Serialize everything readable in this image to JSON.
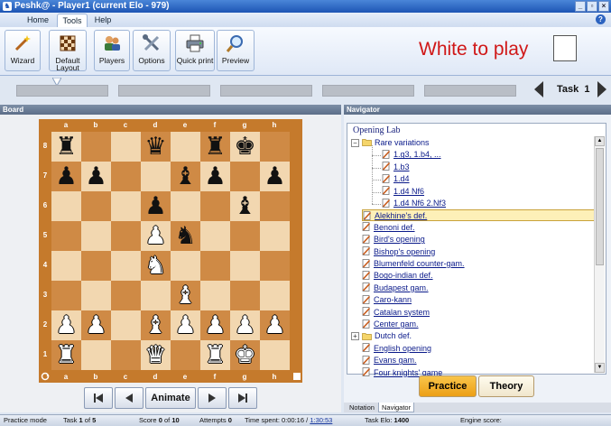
{
  "window": {
    "title": "Peshk@ - Player1 (current Elo - 979)"
  },
  "menu": {
    "tabs": [
      "Home",
      "Tools",
      "Help"
    ],
    "active": "Tools"
  },
  "ribbon": {
    "buttons": [
      {
        "label": "Wizard"
      },
      {
        "label": "Default Layout"
      },
      {
        "label": "Players"
      },
      {
        "label": "Options"
      },
      {
        "label": "Quick print"
      },
      {
        "label": "Preview"
      }
    ],
    "status_text": "White to play"
  },
  "task": {
    "label": "Task",
    "number": "1",
    "segments": 5
  },
  "board_panel": {
    "title": "Board",
    "files": [
      "a",
      "b",
      "c",
      "d",
      "e",
      "f",
      "g",
      "h"
    ],
    "ranks": [
      "8",
      "7",
      "6",
      "5",
      "4",
      "3",
      "2",
      "1"
    ],
    "position": [
      [
        "br",
        "",
        "",
        "bq",
        "",
        "br",
        "bk",
        ""
      ],
      [
        "bp",
        "bp",
        "",
        "",
        "bb",
        "bp",
        "",
        "bp"
      ],
      [
        "",
        "",
        "",
        "bp",
        "",
        "",
        "bb",
        ""
      ],
      [
        "",
        "",
        "",
        "wp",
        "bn",
        "",
        "",
        ""
      ],
      [
        "",
        "",
        "",
        "wn",
        "",
        "",
        "",
        ""
      ],
      [
        "",
        "",
        "",
        "",
        "wb",
        "",
        "",
        ""
      ],
      [
        "wp",
        "wp",
        "",
        "wb",
        "wp",
        "wp",
        "wp",
        "wp"
      ],
      [
        "wr",
        "",
        "",
        "wq",
        "",
        "wr",
        "wk",
        ""
      ]
    ],
    "controls": {
      "animate_label": "Animate"
    }
  },
  "navigator_panel": {
    "title": "Navigator",
    "root": "Opening Lab",
    "items": [
      {
        "label": "Rare variations",
        "type": "folder",
        "level": 0,
        "expanded": true
      },
      {
        "label": "1.g3, 1.b4, ...",
        "type": "page",
        "level": 1
      },
      {
        "label": "1.b3",
        "type": "page",
        "level": 1
      },
      {
        "label": "1.d4",
        "type": "page",
        "level": 1
      },
      {
        "label": "1.d4 Nf6",
        "type": "page",
        "level": 1
      },
      {
        "label": "1.d4 Nf6 2.Nf3",
        "type": "page",
        "level": 1
      },
      {
        "label": "Alekhine's def.",
        "type": "page",
        "level": 0,
        "selected": true
      },
      {
        "label": "Benoni def.",
        "type": "page",
        "level": 0
      },
      {
        "label": "Bird's opening",
        "type": "page",
        "level": 0
      },
      {
        "label": "Bishop's opening",
        "type": "page",
        "level": 0
      },
      {
        "label": "Blumenfeld counter-gam.",
        "type": "page",
        "level": 0
      },
      {
        "label": "Bogo-indian def.",
        "type": "page",
        "level": 0
      },
      {
        "label": "Budapest gam.",
        "type": "page",
        "level": 0
      },
      {
        "label": "Caro-kann",
        "type": "page",
        "level": 0
      },
      {
        "label": "Catalan system",
        "type": "page",
        "level": 0
      },
      {
        "label": "Center gam.",
        "type": "page",
        "level": 0
      },
      {
        "label": "Dutch def.",
        "type": "folder",
        "level": 0,
        "expanded": false
      },
      {
        "label": "English opening",
        "type": "page",
        "level": 0
      },
      {
        "label": "Evans gam.",
        "type": "page",
        "level": 0
      },
      {
        "label": "Four knights' game",
        "type": "page",
        "level": 0
      }
    ],
    "buttons": {
      "practice": "Practice",
      "theory": "Theory"
    },
    "tabs": [
      "Notation",
      "Navigator"
    ],
    "active_tab": "Navigator"
  },
  "status": {
    "mode": "Practice mode",
    "task_label": "Task",
    "task_num": "1",
    "of_label": "of",
    "task_total": "5",
    "score_label": "Score",
    "score_val": "0",
    "score_of": "of",
    "score_max": "10",
    "attempts_label": "Attempts",
    "attempts_val": "0",
    "time_label": "Time spent:",
    "time_spent": "0:00:16",
    "time_sep": "/",
    "time_limit": "1:30:53",
    "elo_label": "Task Elo:",
    "elo_val": "1400",
    "engine_label": "Engine score:"
  },
  "colors": {
    "light_square": "#f2d7b0",
    "dark_square": "#cf8a45",
    "frame": "#c57a2c",
    "accent_red": "#d01818",
    "practice_bg": "#f5b330"
  }
}
